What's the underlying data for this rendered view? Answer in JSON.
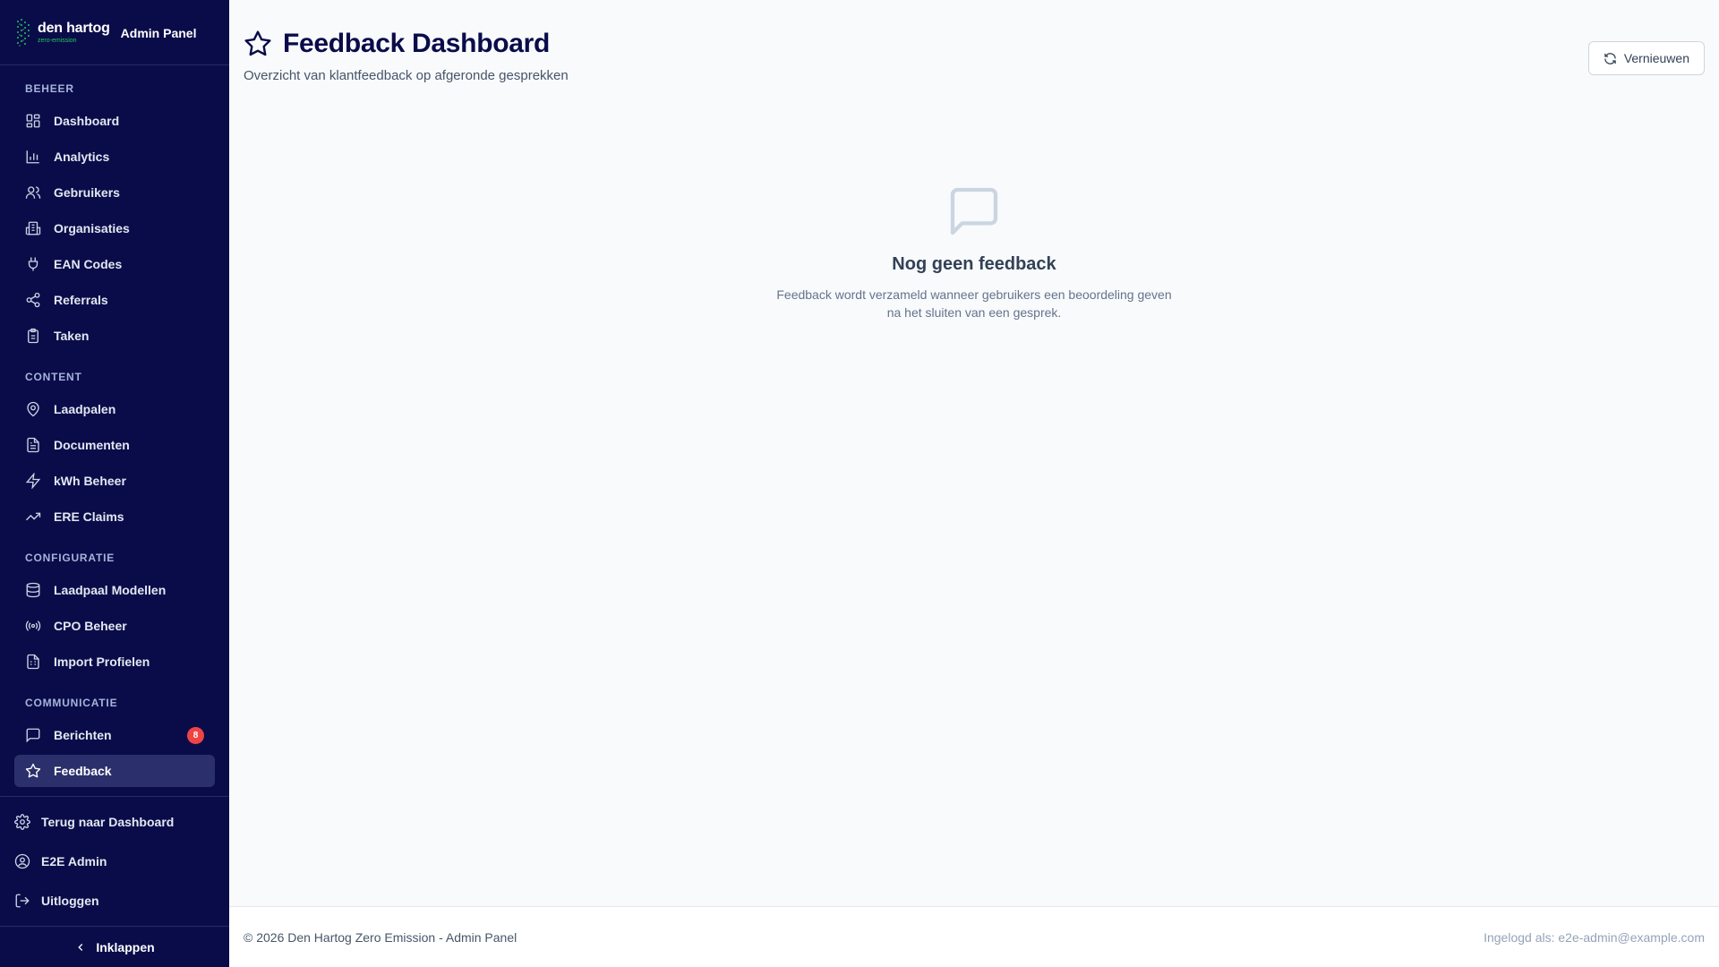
{
  "brand": {
    "logo_name": "den hartog",
    "logo_sub": "zero-emission",
    "panel_title": "Admin Panel",
    "accent_color": "#22c55e",
    "sidebar_color": "#0a0c4a"
  },
  "sidebar": {
    "sections": [
      {
        "title": "BEHEER",
        "items": [
          {
            "label": "Dashboard",
            "icon": "dashboard-grid-icon"
          },
          {
            "label": "Analytics",
            "icon": "bar-chart-icon"
          },
          {
            "label": "Gebruikers",
            "icon": "users-icon"
          },
          {
            "label": "Organisaties",
            "icon": "building-icon"
          },
          {
            "label": "EAN Codes",
            "icon": "plug-icon"
          },
          {
            "label": "Referrals",
            "icon": "share-icon"
          },
          {
            "label": "Taken",
            "icon": "clipboard-icon"
          }
        ]
      },
      {
        "title": "CONTENT",
        "items": [
          {
            "label": "Laadpalen",
            "icon": "map-pin-icon"
          },
          {
            "label": "Documenten",
            "icon": "document-icon"
          },
          {
            "label": "kWh Beheer",
            "icon": "lightning-icon"
          },
          {
            "label": "ERE Claims",
            "icon": "trending-up-icon"
          }
        ]
      },
      {
        "title": "CONFIGURATIE",
        "items": [
          {
            "label": "Laadpaal Modellen",
            "icon": "database-icon"
          },
          {
            "label": "CPO Beheer",
            "icon": "radio-icon"
          },
          {
            "label": "Import Profielen",
            "icon": "spreadsheet-icon"
          }
        ]
      },
      {
        "title": "COMMUNICATIE",
        "items": [
          {
            "label": "Berichten",
            "icon": "message-icon",
            "badge": "8"
          },
          {
            "label": "Feedback",
            "icon": "star-icon",
            "active": true
          }
        ]
      }
    ],
    "footer": {
      "back_label": "Terug naar Dashboard",
      "user_label": "E2E Admin",
      "logout_label": "Uitloggen",
      "collapse_label": "Inklappen"
    }
  },
  "header": {
    "title": "Feedback Dashboard",
    "subtitle": "Overzicht van klantfeedback op afgeronde gesprekken",
    "refresh_label": "Vernieuwen"
  },
  "empty_state": {
    "icon": "message-square-icon",
    "title": "Nog geen feedback",
    "description": "Feedback wordt verzameld wanneer gebruikers een beoordeling geven na het sluiten van een gesprek."
  },
  "footer": {
    "copyright": "© 2026 Den Hartog Zero Emission - Admin Panel",
    "logged_in": "Ingelogd als: e2e-admin@example.com"
  }
}
